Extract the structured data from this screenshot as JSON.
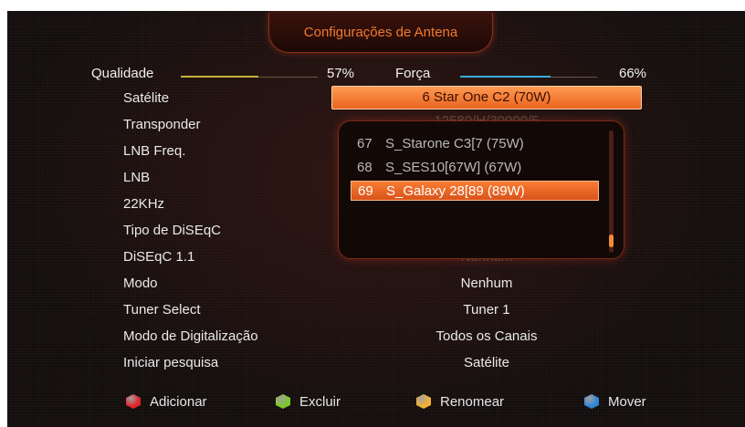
{
  "title": "Configurações de Antena",
  "signal": {
    "quality_label": "Qualidade",
    "quality_value": "57%",
    "quality_color": "#c8b23a",
    "strength_label": "Força",
    "strength_value": "66%",
    "strength_color": "#3aaed8"
  },
  "rows": [
    {
      "label": "Satélite",
      "value": "6 Star One C2 (70W)"
    },
    {
      "label": "Transponder",
      "value": "12580/H/30000/5"
    },
    {
      "label": "LNB Freq.",
      "value": ""
    },
    {
      "label": "LNB",
      "value": ""
    },
    {
      "label": "22KHz",
      "value": ""
    },
    {
      "label": "Tipo de DiSEqC",
      "value": ""
    },
    {
      "label": "DiSEqC 1.1",
      "value": "Nenhum"
    },
    {
      "label": "Modo",
      "value": "Nenhum"
    },
    {
      "label": "Tuner Select",
      "value": "Tuner 1"
    },
    {
      "label": "Modo de Digitalização",
      "value": "Todos os Canais"
    },
    {
      "label": "Iniciar pesquisa",
      "value": "Satélite"
    }
  ],
  "satellite_list": {
    "items": [
      {
        "num": "67",
        "name": "S_Starone C3[7 (75W)"
      },
      {
        "num": "68",
        "name": "S_SES10[67W] (67W)"
      },
      {
        "num": "69",
        "name": "S_Galaxy 28[89 (89W)",
        "selected": true
      }
    ],
    "scroll_position": 0.95
  },
  "legend": [
    {
      "label": "Adicionar",
      "color": "#e0262a",
      "icon": "red-key-icon"
    },
    {
      "label": "Excluir",
      "color": "#7cc82a",
      "icon": "green-key-icon"
    },
    {
      "label": "Renomear",
      "color": "#f2b233",
      "icon": "yellow-key-icon"
    },
    {
      "label": "Mover",
      "color": "#2f86d8",
      "icon": "blue-key-icon"
    }
  ]
}
